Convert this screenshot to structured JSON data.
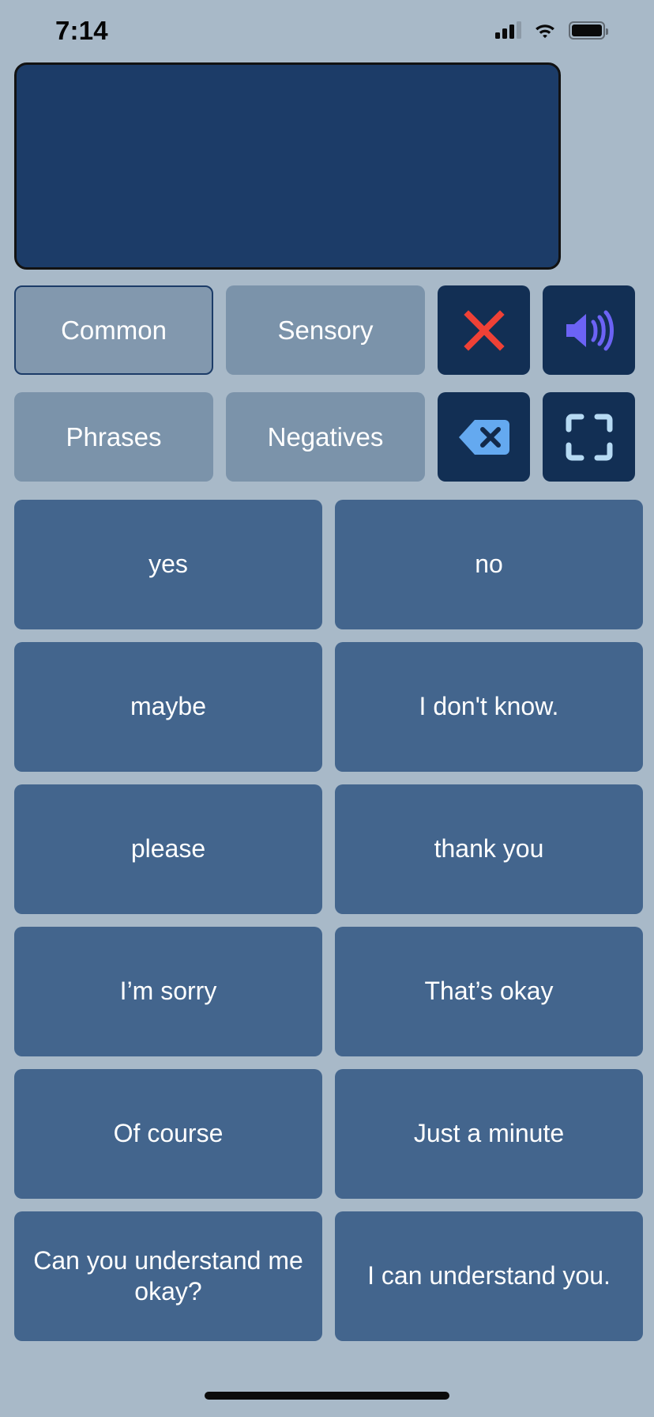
{
  "status_bar": {
    "time": "7:14",
    "cellular_icon": "cellular-signal-icon",
    "wifi_icon": "wifi-icon",
    "battery_icon": "battery-icon"
  },
  "output": {
    "text": "",
    "placeholder": ""
  },
  "categories": {
    "items": [
      {
        "label": "Common",
        "selected": true
      },
      {
        "label": "Sensory",
        "selected": false
      },
      {
        "label": "Phrases",
        "selected": false
      },
      {
        "label": "Negatives",
        "selected": false
      }
    ]
  },
  "controls": [
    {
      "name": "clear-button",
      "icon": "close-x-icon"
    },
    {
      "name": "speak-button",
      "icon": "speaker-volume-icon"
    },
    {
      "name": "backspace-button",
      "icon": "backspace-delete-icon"
    },
    {
      "name": "fullscreen-button",
      "icon": "fullscreen-expand-icon"
    }
  ],
  "colors": {
    "background": "#a8b9c8",
    "output_box": "#1c3c68",
    "output_border": "#121212",
    "category_button": "#7b93aa",
    "category_selected_border": "#1c3c68",
    "control_button": "#122f54",
    "phrase_button": "#43658d",
    "clear_icon": "#ef4136",
    "speak_icon": "#6c63f5",
    "backspace_icon": "#64a9f0",
    "fullscreen_icon": "#b6daf3",
    "text": "#ffffff"
  },
  "phrases": [
    "yes",
    "no",
    "maybe",
    "I don't know.",
    "please",
    "thank you",
    "I’m sorry",
    "That’s okay",
    "Of course",
    "Just a minute",
    "Can you understand me okay?",
    "I can understand you."
  ]
}
